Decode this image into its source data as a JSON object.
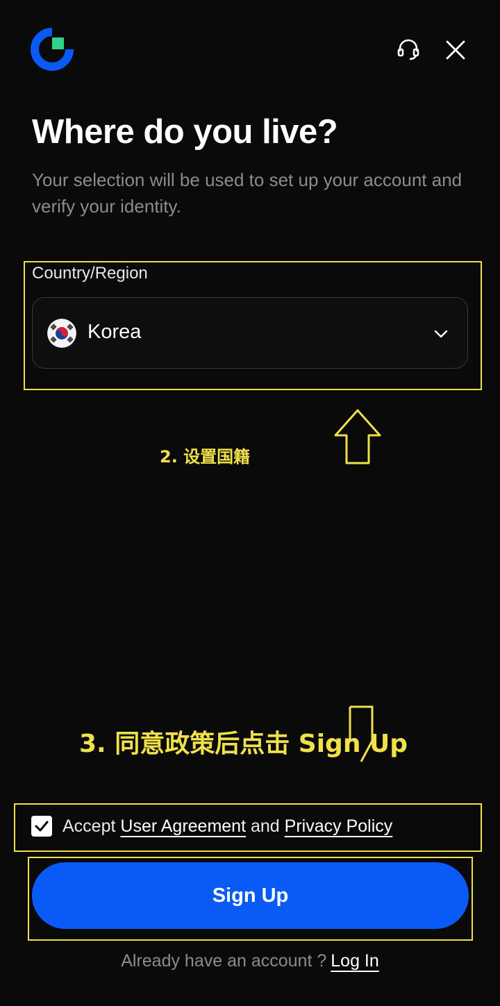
{
  "header": {
    "logo_icon": "app-logo-icon",
    "support_icon": "headset-icon",
    "close_icon": "close-icon"
  },
  "page": {
    "title": "Where do you live?",
    "subtitle": "Your selection will be used to set up your account and verify your identity."
  },
  "country": {
    "label": "Country/Region",
    "value": "Korea",
    "flag_icon": "korea-flag-icon",
    "chevron_icon": "chevron-down-icon"
  },
  "annotations": {
    "step2": "2. 设置国籍",
    "step3": "3. 同意政策后点击 Sign Up",
    "highlight_color": "#f0e04a"
  },
  "agreement": {
    "checked": true,
    "prefix": "Accept",
    "user_agreement": "User Agreement",
    "and": "and",
    "privacy_policy": "Privacy Policy"
  },
  "actions": {
    "signup_label": "Sign Up",
    "signup_color": "#0a5af7",
    "already_text": "Already have an account ?",
    "login_label": "Log In"
  }
}
